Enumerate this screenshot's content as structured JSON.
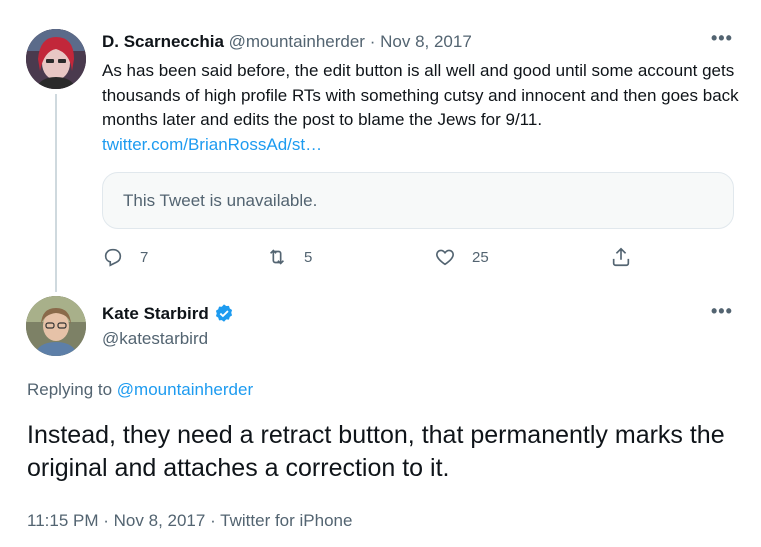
{
  "parent_tweet": {
    "display_name": "D. Scarnecchia",
    "handle": "@mountainherder",
    "separator": "·",
    "date": "Nov 8, 2017",
    "text": "As has been said before, the edit button is all well and good until some account gets thousands of high profile RTs with something cutsy and innocent and then goes back months later and edits the post to blame the Jews for 9/11. ",
    "link": "twitter.com/BrianRossAd/st…",
    "quoted_tweet_text": "This Tweet is unavailable.",
    "reply_count": "7",
    "retweet_count": "5",
    "like_count": "25",
    "more_label": "•••"
  },
  "reply_tweet": {
    "display_name": "Kate Starbird",
    "handle": "@katestarbird",
    "replying_prefix": "Replying to ",
    "replying_to": "@mountainherder",
    "text": "Instead, they need a retract button, that permanently marks the original and attaches a correction to it.",
    "time": "11:15 PM",
    "separator": "·",
    "date": "Nov 8, 2017",
    "source": "Twitter for iPhone",
    "more_label": "•••"
  },
  "colors": {
    "accent": "#1d9bf0",
    "secondary_text": "#536471",
    "primary_text": "#0f1419",
    "thread_line": "#cfd9de"
  },
  "icons": [
    "reply-icon",
    "retweet-icon",
    "like-icon",
    "share-icon",
    "verified-badge-icon",
    "more-icon"
  ]
}
